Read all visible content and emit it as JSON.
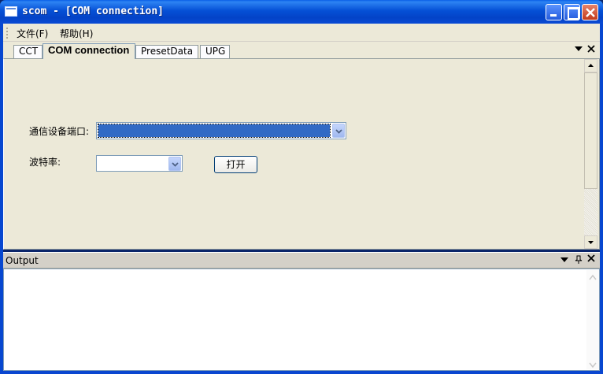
{
  "window": {
    "title": "scom - [COM connection]"
  },
  "menubar": {
    "items": [
      {
        "label": "文件(F)"
      },
      {
        "label": "帮助(H)"
      }
    ]
  },
  "tabs": [
    {
      "label": "CCT",
      "active": false
    },
    {
      "label": "COM connection",
      "active": true
    },
    {
      "label": "PresetData",
      "active": false
    },
    {
      "label": "UPG",
      "active": false
    }
  ],
  "form": {
    "port_label": "通信设备端口:",
    "port_value": "",
    "baud_label": "波特率:",
    "baud_value": "",
    "open_button": "打开"
  },
  "output": {
    "title": "Output",
    "content": ""
  },
  "colors": {
    "titlebar": "#0550d6",
    "selection": "#316ac5",
    "face": "#ece9d8"
  }
}
